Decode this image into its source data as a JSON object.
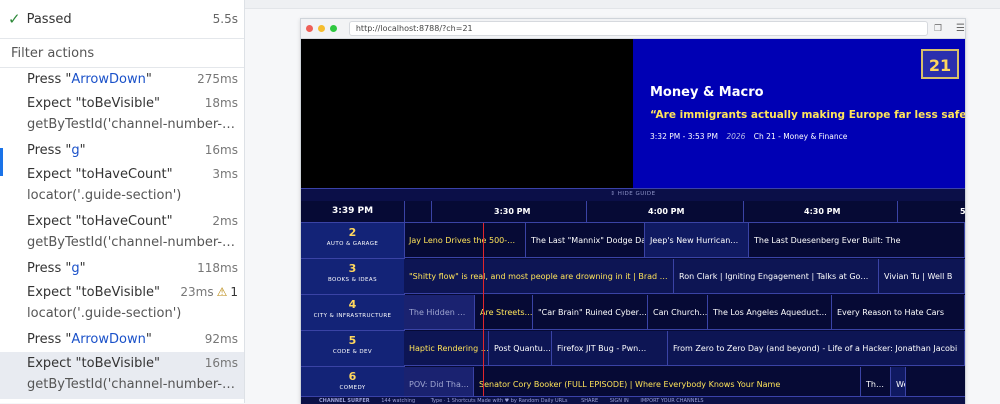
{
  "left_panel": {
    "status": {
      "label": "Passed",
      "duration": "5.5s"
    },
    "filter_label": "Filter actions",
    "actions": [
      {
        "prefix": "Press \"",
        "keyword": "ArrowDown",
        "suffix": "\"",
        "duration": "275ms",
        "subtitle": null,
        "warn": null
      },
      {
        "prefix": "Expect \"toBeVisible\"",
        "keyword": "",
        "suffix": "",
        "duration": "18ms",
        "subtitle": "getByTestId('channel-number-bad…",
        "warn": null
      },
      {
        "prefix": "Press \"",
        "keyword": "g",
        "suffix": "\"",
        "duration": "16ms",
        "subtitle": null,
        "warn": null
      },
      {
        "prefix": "Expect \"toHaveCount\"",
        "keyword": "",
        "suffix": "",
        "duration": "3ms",
        "subtitle": "locator('.guide-section')",
        "warn": null
      },
      {
        "prefix": "Expect \"toHaveCount\"",
        "keyword": "",
        "suffix": "",
        "duration": "2ms",
        "subtitle": "getByTestId('channel-number-bad…",
        "warn": null
      },
      {
        "prefix": "Press \"",
        "keyword": "g",
        "suffix": "\"",
        "duration": "118ms",
        "subtitle": null,
        "warn": null
      },
      {
        "prefix": "Expect \"toBeVisible\"",
        "keyword": "",
        "suffix": "",
        "duration": "23ms",
        "subtitle": "locator('.guide-section')",
        "warn": "1"
      },
      {
        "prefix": "Press \"",
        "keyword": "ArrowDown",
        "suffix": "\"",
        "duration": "92ms",
        "subtitle": null,
        "warn": null
      },
      {
        "prefix": "Expect \"toBeVisible\"",
        "keyword": "",
        "suffix": "",
        "duration": "16ms",
        "subtitle": "getByTestId('channel-number-bad…",
        "warn": null,
        "selected": true
      }
    ]
  },
  "browser": {
    "url": "http://localhost:8788/?ch=21",
    "info": {
      "channel_badge": "21",
      "show_title": "Money & Macro",
      "episode_title": "“Are immigrants actually making Europe far less safe?”",
      "time_range": "3:32 PM - 3:53 PM",
      "year": "2026",
      "channel_label": "Ch 21 - Money & Finance"
    },
    "hide_guide": "HIDE GUIDE",
    "guide": {
      "now": "3:39 PM",
      "times": [
        "3:30 PM",
        "4:00 PM",
        "4:30 PM",
        "5"
      ],
      "channels": [
        {
          "num": "2",
          "name": "AUTO & GARAGE",
          "programs": [
            "Jay Leno Drives the 500-…",
            "The Last \"Mannix\" Dodge Dart: Resurrectin…",
            "Jeep's New Hurrican…",
            "The Last Duesenberg Ever Built: The"
          ]
        },
        {
          "num": "3",
          "name": "BOOKS & IDEAS",
          "programs": [
            "\"Shitty flow\" is real, and most people are drowning in it | Brad …",
            "Ron Clark | Igniting Engagement | Talks at Go…",
            "Vivian Tu | Well B"
          ]
        },
        {
          "num": "4",
          "name": "CITY & INFRASTRUCTURE",
          "programs": [
            "The Hidden …",
            "Are Streets…",
            "\"Car Brain\" Ruined Cyber…",
            "Can Church…",
            "The Los Angeles Aqueduct…",
            "Every Reason to Hate Cars"
          ]
        },
        {
          "num": "5",
          "name": "CODE & DEV",
          "programs": [
            "Haptic Rendering …",
            "Post Quantu…",
            "Firefox JIT Bug - Pwn…",
            "From Zero to Zero Day (and beyond) - Life of a Hacker: Jonathan Jacobi"
          ]
        },
        {
          "num": "6",
          "name": "COMEDY",
          "programs": [
            "POV: Did Tha…",
            "Senator Cory Booker (FULL EPISODE) | Where Everybody Knows Your Name",
            "Th…",
            "Weekend U"
          ]
        }
      ]
    },
    "footer": {
      "brand": "CHANNEL SURFER",
      "watching": "144 watching",
      "type_hint": "Type · 1 Shortcuts Made with ♥ by Random Daily URLs",
      "share": "SHARE",
      "sign_in": "SIGN IN",
      "import": "IMPORT YOUR CHANNELS"
    }
  }
}
